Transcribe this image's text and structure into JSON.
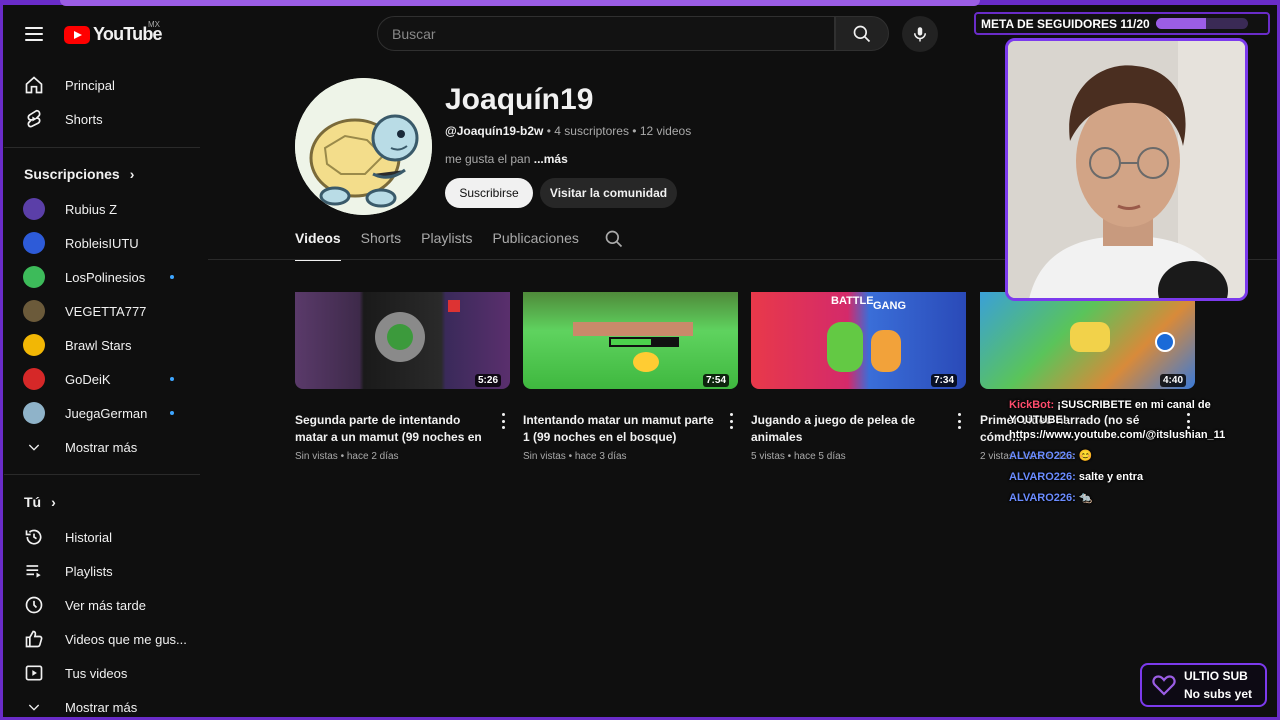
{
  "header": {
    "logo_text": "YouTube",
    "country": "MX",
    "search_placeholder": "Buscar"
  },
  "sidebar": {
    "main": [
      {
        "label": "Principal",
        "icon": "home-icon"
      },
      {
        "label": "Shorts",
        "icon": "shorts-icon"
      }
    ],
    "subscriptions_heading": "Suscripciones",
    "subscriptions": [
      {
        "label": "Rubius Z",
        "color": "#5b3fa8",
        "new": false
      },
      {
        "label": "RobleisIUTU",
        "color": "#2d5bd8",
        "new": false
      },
      {
        "label": "LosPolinesios",
        "color": "#3dbb5a",
        "new": true
      },
      {
        "label": "VEGETTA777",
        "color": "#6b5a3a",
        "new": false
      },
      {
        "label": "Brawl Stars",
        "color": "#f2b705",
        "new": false
      },
      {
        "label": "GoDeiK",
        "color": "#d62828",
        "new": true
      },
      {
        "label": "JuegaGerman",
        "color": "#8fb3c9",
        "new": true
      }
    ],
    "show_more_1": "Mostrar más",
    "you_heading": "Tú",
    "you_items": [
      {
        "label": "Historial",
        "icon": "history-icon"
      },
      {
        "label": "Playlists",
        "icon": "playlists-icon"
      },
      {
        "label": "Ver más tarde",
        "icon": "watch-later-icon"
      },
      {
        "label": "Videos que me gus...",
        "icon": "like-icon"
      },
      {
        "label": "Tus videos",
        "icon": "your-videos-icon"
      }
    ],
    "show_more_2": "Mostrar más"
  },
  "channel": {
    "name": "Joaquín19",
    "handle": "@Joaquín19-b2w",
    "subscribers": " • 4 suscriptores • 12 videos",
    "description": "me gusta el pan ",
    "more": "...más",
    "subscribe_label": "Suscribirse",
    "community_label": "Visitar la comunidad"
  },
  "tabs": [
    "Videos",
    "Shorts",
    "Playlists",
    "Publicaciones"
  ],
  "videos": [
    {
      "title": "Segunda parte de intentando matar a un mamut (99 noches en el...",
      "meta": "Sin vistas • hace 2 días",
      "duration": "5:26"
    },
    {
      "title": "Intentando matar un mamut parte 1 (99 noches en el bosque)",
      "meta": "Sin vistas • hace 3 días",
      "duration": "7:54"
    },
    {
      "title": "Jugando a juego de pelea de animales",
      "meta": "5 vistas • hace 5 días",
      "duration": "7:34"
    },
    {
      "title": "Primer video narrado (no sé cómo...",
      "meta": "2 vistas • hace 6 días",
      "duration": "4:40"
    }
  ],
  "thumb3_text": {
    "a": "BATTLE",
    "b": "GANG"
  },
  "overlay": {
    "goal_text": "META DE SEGUIDORES 11/20",
    "goal_progress": 0.55,
    "chat": [
      {
        "user": "KickBot:",
        "msg": " ¡SUSCRIBETE en mi canal de YOUTUBE! https://www.youtube.com/@itslushian_11",
        "bot": true
      },
      {
        "user": "ALVARO226:",
        "msg": " 😊",
        "bot": false
      },
      {
        "user": "ALVARO226:",
        "msg": " salte y entra",
        "bot": false
      },
      {
        "user": "ALVARO226:",
        "msg": " 🐀",
        "bot": false
      }
    ],
    "last_sub_title": "ULTIO SUB",
    "last_sub_value": "No subs yet"
  },
  "colors": {
    "accent": "#7c3aed",
    "youtube_red": "#ff0000",
    "link_blue": "#3ea6ff"
  }
}
